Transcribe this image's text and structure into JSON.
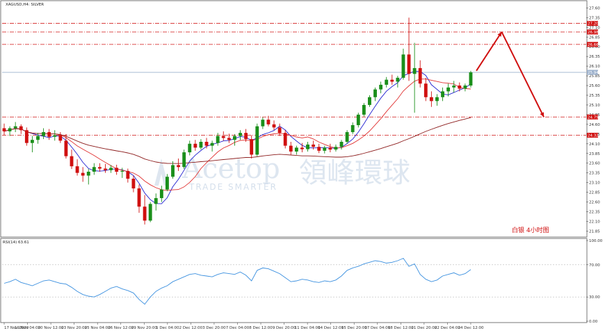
{
  "header": {
    "title": "XAGUSD,H4: SILVER"
  },
  "annotation": "白银  4小时图",
  "watermark": {
    "brand": "Acetop",
    "brand_cn": "領峰環球",
    "tagline": "TRADE SMARTER"
  },
  "rsi_label": "RSI(14) 63.61",
  "colors": {
    "bull": "#1a8f1a",
    "bear": "#d01010",
    "ma_fast": "#2020d0",
    "ma_mid": "#e03030",
    "ma_slow": "#8b1a1a",
    "rsi": "#3a8fdf",
    "level": "#d01010"
  },
  "chart_data": [
    {
      "type": "candlestick",
      "title": "XAGUSD,H4: SILVER",
      "ylim": [
        21.75,
        27.75
      ],
      "y_ticks": [
        "27.60",
        "27.35",
        "27.10",
        "26.85",
        "26.60",
        "26.35",
        "26.10",
        "25.85",
        "25.60",
        "25.35",
        "25.10",
        "24.85",
        "24.60",
        "24.35",
        "24.10",
        "23.85",
        "23.60",
        "23.35",
        "23.10",
        "22.85",
        "22.60",
        "22.35",
        "22.10",
        "21.85"
      ],
      "x_ticks": [
        "17 Nov 2020",
        "19 Nov 04:00",
        "20 Nov 12:00",
        "23 Nov 20:00",
        "25 Nov 04:00",
        "26 Nov 12:00",
        "29 Nov 20:00",
        "1 Dec 04:00",
        "2 Dec 12:00",
        "3 Dec 20:00",
        "7 Dec 04:00",
        "8 Dec 12:00",
        "9 Dec 20:00",
        "11 Dec 04:00",
        "14 Dec 12:00",
        "15 Dec 20:00",
        "17 Dec 04:00",
        "18 Dec 12:00",
        "21 Dec 20:00",
        "22 Dec 04:00",
        "24 Dec 12:00"
      ],
      "horizontal_levels": [
        {
          "value": 27.2,
          "label": "27.20",
          "style": "dash-dot"
        },
        {
          "value": 26.98,
          "label": "26.98",
          "style": "dash-dot"
        },
        {
          "value": 26.66,
          "label": "26.66",
          "style": "dash-dot"
        },
        {
          "value": 24.79,
          "label": "24.79",
          "style": "dash-dot"
        },
        {
          "value": 24.32,
          "label": "24.32",
          "style": "dash-dot"
        }
      ],
      "current_price": {
        "value": 25.94,
        "label": "25.94"
      },
      "projection": [
        {
          "x": 84,
          "y": 25.98
        },
        {
          "x": 88.5,
          "y": 26.98
        },
        {
          "x": 96,
          "y": 24.79
        }
      ],
      "candles": [
        [
          24.5,
          24.62,
          24.32,
          24.42
        ],
        [
          24.42,
          24.55,
          24.3,
          24.5
        ],
        [
          24.5,
          24.66,
          24.4,
          24.55
        ],
        [
          24.55,
          24.6,
          24.35,
          24.45
        ],
        [
          24.45,
          24.52,
          24.05,
          24.12
        ],
        [
          24.12,
          24.3,
          23.88,
          24.2
        ],
        [
          24.2,
          24.38,
          24.1,
          24.3
        ],
        [
          24.3,
          24.5,
          24.22,
          24.4
        ],
        [
          24.4,
          24.48,
          24.2,
          24.28
        ],
        [
          24.28,
          24.45,
          24.18,
          24.32
        ],
        [
          24.32,
          24.4,
          24.12,
          24.18
        ],
        [
          24.18,
          24.35,
          23.72,
          23.78
        ],
        [
          23.78,
          23.95,
          23.45,
          23.52
        ],
        [
          23.52,
          23.7,
          23.28,
          23.35
        ],
        [
          23.35,
          23.5,
          23.12,
          23.28
        ],
        [
          23.28,
          23.45,
          23.05,
          23.38
        ],
        [
          23.38,
          23.6,
          23.3,
          23.5
        ],
        [
          23.5,
          23.6,
          23.38,
          23.46
        ],
        [
          23.46,
          23.58,
          23.35,
          23.42
        ],
        [
          23.42,
          23.55,
          23.35,
          23.48
        ],
        [
          23.48,
          23.56,
          23.3,
          23.38
        ],
        [
          23.38,
          23.48,
          23.22,
          23.4
        ],
        [
          23.4,
          23.46,
          23.1,
          23.2
        ],
        [
          23.2,
          23.28,
          22.85,
          22.95
        ],
        [
          22.95,
          23.05,
          22.32,
          22.48
        ],
        [
          22.48,
          22.78,
          22.02,
          22.12
        ],
        [
          22.12,
          22.6,
          22.08,
          22.55
        ],
        [
          22.55,
          22.82,
          22.38,
          22.7
        ],
        [
          22.7,
          23.02,
          22.6,
          22.92
        ],
        [
          22.92,
          23.32,
          22.88,
          23.25
        ],
        [
          23.25,
          23.65,
          23.2,
          23.55
        ],
        [
          23.55,
          23.72,
          23.4,
          23.5
        ],
        [
          23.5,
          23.95,
          23.45,
          23.88
        ],
        [
          23.88,
          24.18,
          23.8,
          24.1
        ],
        [
          24.1,
          24.2,
          23.92,
          24.0
        ],
        [
          24.0,
          24.22,
          23.95,
          24.15
        ],
        [
          24.15,
          24.25,
          23.98,
          24.05
        ],
        [
          24.05,
          24.18,
          23.9,
          24.12
        ],
        [
          24.12,
          24.38,
          24.05,
          24.3
        ],
        [
          24.3,
          24.42,
          24.18,
          24.25
        ],
        [
          24.25,
          24.36,
          24.12,
          24.2
        ],
        [
          24.2,
          24.35,
          24.05,
          24.3
        ],
        [
          24.3,
          24.45,
          24.2,
          24.38
        ],
        [
          24.38,
          24.48,
          24.15,
          24.22
        ],
        [
          24.22,
          24.32,
          23.72,
          23.82
        ],
        [
          23.82,
          24.62,
          23.78,
          24.55
        ],
        [
          24.55,
          24.78,
          24.48,
          24.72
        ],
        [
          24.72,
          24.82,
          24.55,
          24.6
        ],
        [
          24.6,
          24.7,
          24.45,
          24.52
        ],
        [
          24.52,
          24.62,
          24.3,
          24.38
        ],
        [
          24.38,
          24.45,
          23.98,
          24.05
        ],
        [
          24.05,
          24.15,
          23.82,
          23.9
        ],
        [
          23.9,
          24.05,
          23.82,
          24.0
        ],
        [
          24.0,
          24.12,
          23.88,
          23.96
        ],
        [
          23.96,
          24.15,
          23.9,
          24.08
        ],
        [
          24.08,
          24.18,
          23.95,
          24.02
        ],
        [
          24.02,
          24.1,
          23.86,
          23.92
        ],
        [
          23.92,
          24.05,
          23.85,
          24.0
        ],
        [
          24.0,
          24.1,
          23.88,
          23.95
        ],
        [
          23.95,
          24.08,
          23.9,
          24.02
        ],
        [
          24.02,
          24.2,
          23.95,
          24.15
        ],
        [
          24.15,
          24.45,
          24.1,
          24.4
        ],
        [
          24.4,
          24.65,
          24.35,
          24.58
        ],
        [
          24.58,
          24.9,
          24.52,
          24.85
        ],
        [
          24.85,
          25.15,
          24.8,
          25.1
        ],
        [
          25.1,
          25.35,
          25.05,
          25.3
        ],
        [
          25.3,
          25.55,
          25.2,
          25.5
        ],
        [
          25.5,
          25.7,
          25.4,
          25.62
        ],
        [
          25.62,
          25.82,
          25.55,
          25.75
        ],
        [
          25.75,
          25.88,
          25.62,
          25.7
        ],
        [
          25.7,
          25.85,
          25.55,
          25.8
        ],
        [
          25.8,
          26.55,
          25.75,
          26.4
        ],
        [
          26.4,
          27.35,
          25.72,
          25.9
        ],
        [
          25.9,
          26.7,
          24.9,
          26.05
        ],
        [
          26.05,
          26.25,
          25.55,
          25.65
        ],
        [
          25.65,
          25.8,
          25.2,
          25.3
        ],
        [
          25.3,
          25.45,
          25.05,
          25.2
        ],
        [
          25.2,
          25.38,
          25.08,
          25.3
        ],
        [
          25.3,
          25.55,
          25.2,
          25.45
        ],
        [
          25.45,
          25.65,
          25.32,
          25.55
        ],
        [
          25.55,
          25.72,
          25.42,
          25.6
        ],
        [
          25.6,
          25.68,
          25.45,
          25.52
        ],
        [
          25.52,
          25.65,
          25.45,
          25.6
        ],
        [
          25.6,
          25.98,
          25.55,
          25.94
        ]
      ],
      "moving_averages": [
        {
          "period": 5,
          "color": "#2020d0"
        },
        {
          "period": 10,
          "color": "#e03030"
        },
        {
          "period": 50,
          "color": "#8b1a1a"
        }
      ]
    },
    {
      "type": "line",
      "title": "RSI(14) 63.61",
      "ylim": [
        0,
        100
      ],
      "y_ticks": [
        "100.00",
        "70.00",
        "30.00",
        "0.00"
      ],
      "levels": [
        70,
        30
      ],
      "series": [
        {
          "values": [
            47,
            49,
            52,
            48,
            46,
            44,
            47,
            50,
            51,
            49,
            47,
            46,
            42,
            37,
            33,
            31,
            30,
            33,
            37,
            41,
            43,
            40,
            38,
            35,
            27,
            21,
            30,
            37,
            41,
            44,
            49,
            52,
            55,
            58,
            59,
            57,
            56,
            55,
            58,
            60,
            59,
            58,
            61,
            57,
            50,
            63,
            66,
            65,
            62,
            59,
            54,
            49,
            50,
            52,
            51,
            49,
            48,
            50,
            49,
            51,
            56,
            63,
            66,
            68,
            71,
            73,
            75,
            74,
            72,
            73,
            75,
            78,
            68,
            71,
            58,
            52,
            49,
            51,
            56,
            58,
            60,
            57,
            59,
            64
          ]
        }
      ]
    }
  ]
}
